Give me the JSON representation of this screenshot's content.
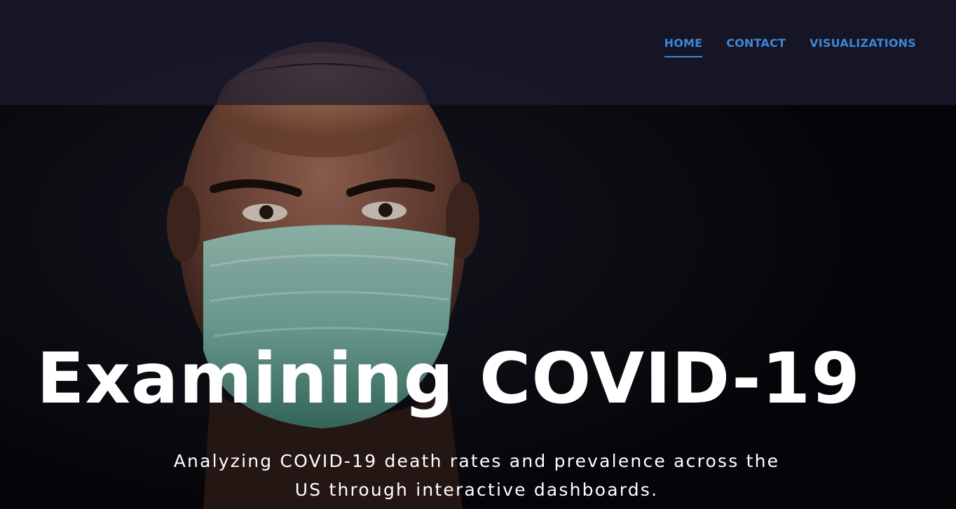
{
  "nav": {
    "items": [
      {
        "label": "HOME",
        "active": true
      },
      {
        "label": "CONTACT",
        "active": false
      },
      {
        "label": "VISUALIZATIONS",
        "active": false
      }
    ]
  },
  "hero": {
    "title": "Examining COVID-19",
    "subtitle": "Analyzing COVID-19 death rates and prevalence across the US through interactive dashboards.",
    "image": "person-wearing-surgical-mask"
  },
  "colors": {
    "accent": "#3d86d6",
    "header_bg": "#1c1c30",
    "page_bg": "#0c0c14",
    "text": "#ffffff",
    "mask": "#8fc4b8"
  }
}
